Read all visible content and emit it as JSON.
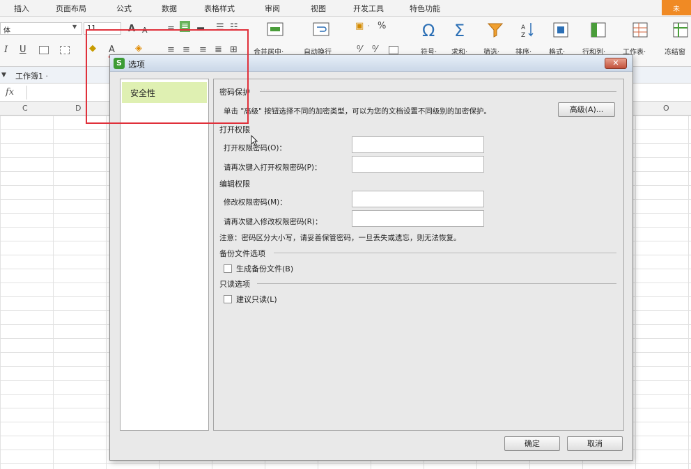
{
  "ribbon": {
    "tabs": [
      "插入",
      "页面布局",
      "公式",
      "数据",
      "表格样式",
      "审阅",
      "视图",
      "开发工具",
      "特色功能"
    ],
    "unsaved_badge": "未",
    "font_name": "体",
    "font_size": "11",
    "groups": [
      {
        "label": "合并居中·",
        "icon": "merge-center-icon"
      },
      {
        "label": "自动换行",
        "icon": "wrap-text-icon"
      },
      {
        "label": "符号·",
        "icon": "omega-icon"
      },
      {
        "label": "求和·",
        "icon": "sigma-icon"
      },
      {
        "label": "筛选·",
        "icon": "funnel-icon"
      },
      {
        "label": "排序·",
        "icon": "sort-icon"
      },
      {
        "label": "格式·",
        "icon": "format-icon"
      },
      {
        "label": "行和列·",
        "icon": "rows-cols-icon"
      },
      {
        "label": "工作表·",
        "icon": "worksheet-icon"
      },
      {
        "label": "冻结窗",
        "icon": "freeze-icon"
      }
    ],
    "number_format_symbol": "%"
  },
  "workbook": {
    "tab_label": "工作簿1 ·",
    "fx_label": "fx"
  },
  "columns": [
    "C",
    "D",
    "O"
  ],
  "dialog": {
    "title": "选项",
    "logo_letter": "S",
    "close_label": "✕",
    "sidebar": {
      "items": [
        {
          "label": "安全性"
        }
      ]
    },
    "password_protection": {
      "heading": "密码保护",
      "description": "单击 \"高级\" 按钮选择不同的加密类型，可以为您的文档设置不同级别的加密保护。",
      "advanced_button": "高级(A)..."
    },
    "open_permission": {
      "heading": "打开权限",
      "password_label": "打开权限密码(O)：",
      "confirm_label": "请再次键入打开权限密码(P)：",
      "password_value": "",
      "confirm_value": ""
    },
    "edit_permission": {
      "heading": "编辑权限",
      "password_label": "修改权限密码(M)：",
      "confirm_label": "请再次键入修改权限密码(R)：",
      "password_value": "",
      "confirm_value": ""
    },
    "note": "注意：密码区分大小写，请妥善保管密码，一旦丢失或遗忘，则无法恢复。",
    "backup": {
      "heading": "备份文件选项",
      "checkbox_label": "生成备份文件(B)",
      "checked": false
    },
    "readonly": {
      "heading": "只读选项",
      "checkbox_label": "建议只读(L)",
      "checked": false
    },
    "ok_button": "确定",
    "cancel_button": "取消"
  },
  "colors": {
    "sidebar_selected": "#dff0b2",
    "highlight_box": "#e0303a",
    "close_button": "#c2523c",
    "app_logo": "#3c9b35"
  }
}
